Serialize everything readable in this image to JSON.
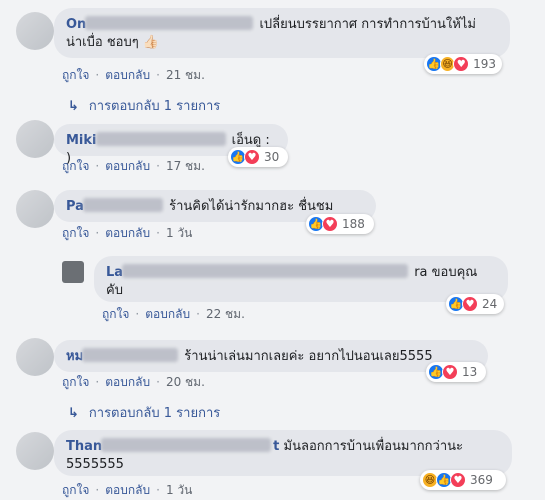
{
  "actions": {
    "like": "ถูกใจ",
    "reply": "ตอบกลับ"
  },
  "comments": [
    {
      "name_visible": "On",
      "text_line1": "เปลี่ยนบรรยากาศ การทำการบ้านให้ไม่",
      "text_line2": "น่าเบื่อ ชอบๆ",
      "emoji": "👍🏻",
      "time": "21 ชม.",
      "react_count": "193",
      "reactions": [
        "like",
        "haha",
        "love"
      ]
    },
    {
      "name_visible": "Miki",
      "text": "เอ็นดู : )",
      "time": "17 ชม.",
      "react_count": "30",
      "reactions": [
        "like",
        "love"
      ]
    },
    {
      "name_visible": "Pa",
      "text": "ร้านคิดได้น่ารักมากฮะ ชื่นชม",
      "time": "1 วัน",
      "react_count": "188",
      "reactions": [
        "like",
        "love"
      ]
    },
    {
      "name_visible": "La",
      "text_line1": "ra ขอบคุณ",
      "text_line2": "คับ",
      "time": "22 ชม.",
      "react_count": "24",
      "reactions": [
        "like",
        "love"
      ]
    },
    {
      "name_visible": "หม",
      "text": "ร้านน่าเล่นมากเลยค่ะ อยากไปนอนเลย5555",
      "time": "20 ชม.",
      "react_count": "13",
      "reactions": [
        "like",
        "love"
      ]
    },
    {
      "name_visible": "Than",
      "name_suffix": "t",
      "text_line1": "มันลอกการบ้านเพื่อนมากกว่านะ",
      "text_line2": "5555555",
      "time": "1 วัน",
      "react_count": "369",
      "reactions": [
        "haha",
        "like",
        "love"
      ]
    }
  ],
  "replies_link_1": "การตอบกลับ 1 รายการ",
  "replies_link_2": "การตอบกลับ 1 รายการ",
  "colors": {
    "link": "#385898",
    "bubble": "#e4e6eb",
    "like": "#1877f2",
    "love": "#f33e58",
    "haha": "#f7b125"
  }
}
